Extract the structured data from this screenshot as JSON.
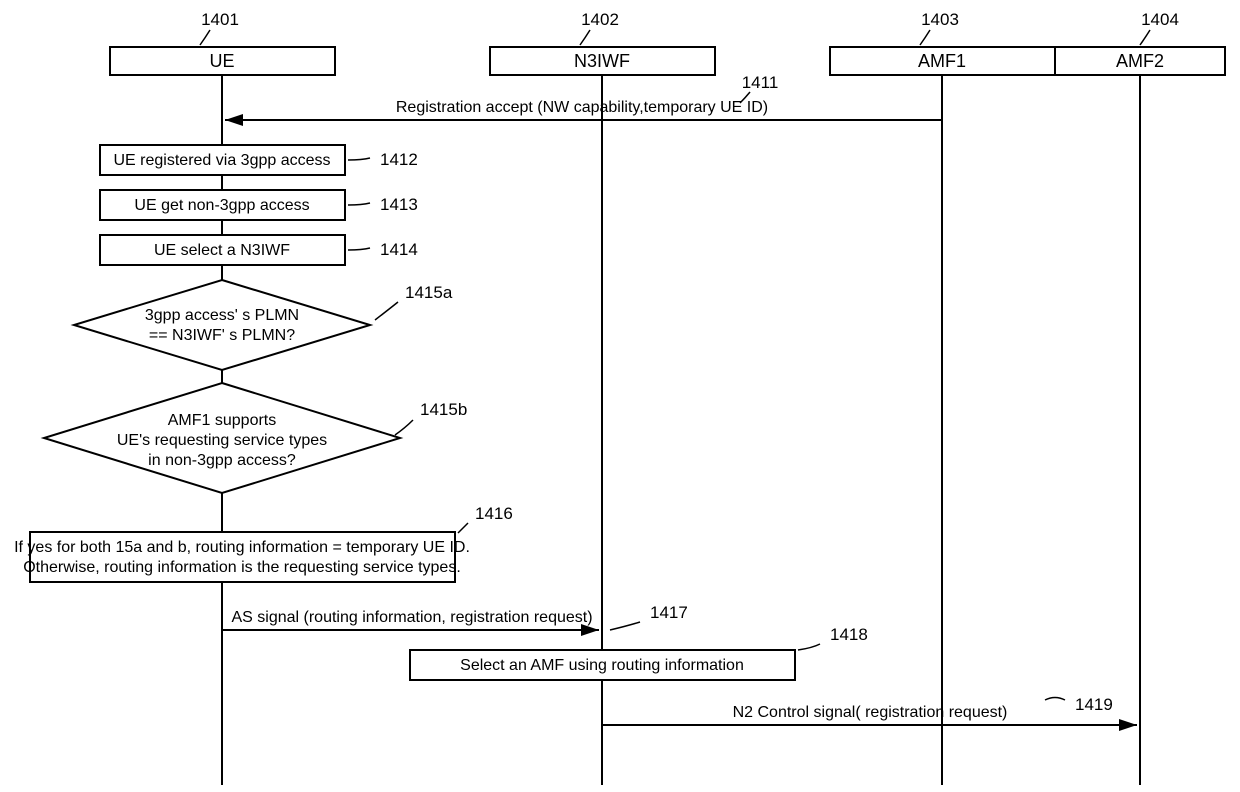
{
  "actors": {
    "ue": {
      "label": "UE",
      "ref": "1401"
    },
    "n3iwf": {
      "label": "N3IWF",
      "ref": "1402"
    },
    "amf1": {
      "label": "AMF1",
      "ref": "1403"
    },
    "amf2": {
      "label": "AMF2",
      "ref": "1404"
    }
  },
  "messages": {
    "m1411": {
      "text": "Registration accept (NW capability,temporary UE ID)",
      "ref": "1411"
    },
    "m1417": {
      "text": "AS signal (routing information, registration request)",
      "ref": "1417"
    },
    "m1419": {
      "text": "N2 Control signal( registration request)",
      "ref": "1419"
    }
  },
  "steps": {
    "s1412": {
      "text": "UE registered via 3gpp access",
      "ref": "1412"
    },
    "s1413": {
      "text": "UE get non-3gpp access",
      "ref": "1413"
    },
    "s1414": {
      "text": "UE select a N3IWF",
      "ref": "1414"
    },
    "s1415a": {
      "line1": "3gpp access' s PLMN",
      "line2": "== N3IWF' s PLMN?",
      "ref": "1415a"
    },
    "s1415b": {
      "line1": "AMF1 supports",
      "line2": "UE's requesting service types",
      "line3": "in non-3gpp access?",
      "ref": "1415b"
    },
    "s1416": {
      "line1": "If yes for both 15a and b, routing information = temporary UE ID.",
      "line2": "Otherwise, routing information is the requesting service types.",
      "ref": "1416"
    },
    "s1418": {
      "text": "Select an AMF using routing information",
      "ref": "1418"
    }
  }
}
